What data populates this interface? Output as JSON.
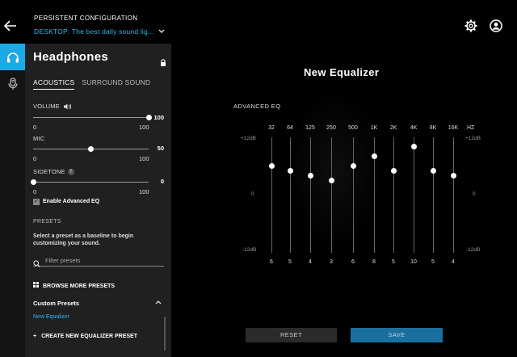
{
  "header": {
    "config_label": "PERSISTENT CONFIGURATION",
    "config_value": "DESKTOP: The best daily sound lig..."
  },
  "panel": {
    "title": "Headphones",
    "tabs": [
      {
        "label": "ACOUSTICS",
        "active": true
      },
      {
        "label": "SURROUND SOUND",
        "active": false
      }
    ],
    "volume": {
      "label": "VOLUME",
      "value": "100",
      "min": "0",
      "max": "100",
      "level": 1.0
    },
    "mic": {
      "label": "MIC",
      "value": "50",
      "min": "0",
      "max": "100",
      "level": 0.5
    },
    "sidetone": {
      "label": "SIDETONE",
      "value": "0",
      "min": "0",
      "max": "100",
      "level": 0.0
    },
    "advanced_eq_label": "Enable Advanced EQ",
    "advanced_eq_enabled": true,
    "presets_heading": "PRESETS",
    "presets_desc": "Select a preset as a baseline to begin customizing your sound.",
    "filter_placeholder": "Filter presets",
    "browse_label": "BROWSE MORE PRESETS",
    "custom_heading": "Custom Presets",
    "custom_items": [
      "New Equalizer"
    ],
    "create_label": "CREATE NEW EQUALIZER PRESET"
  },
  "equalizer": {
    "title": "New Equalizer",
    "section_label": "ADVANCED EQ",
    "hz_label": "HZ",
    "db_top": "+12dB",
    "db_mid": "0",
    "db_bottom": "-12dB",
    "bands": [
      {
        "freq": "32",
        "value": 6
      },
      {
        "freq": "64",
        "value": 5
      },
      {
        "freq": "125",
        "value": 4
      },
      {
        "freq": "250",
        "value": 3
      },
      {
        "freq": "500",
        "value": 6
      },
      {
        "freq": "1K",
        "value": 8
      },
      {
        "freq": "2K",
        "value": 5
      },
      {
        "freq": "4K",
        "value": 10
      },
      {
        "freq": "8K",
        "value": 5
      },
      {
        "freq": "16K",
        "value": 4
      }
    ],
    "reset_label": "RESET",
    "save_label": "SAVE"
  },
  "colors": {
    "accent": "#1da8e6",
    "link": "#2fb8f0",
    "save_bg": "#1a6f9e"
  }
}
